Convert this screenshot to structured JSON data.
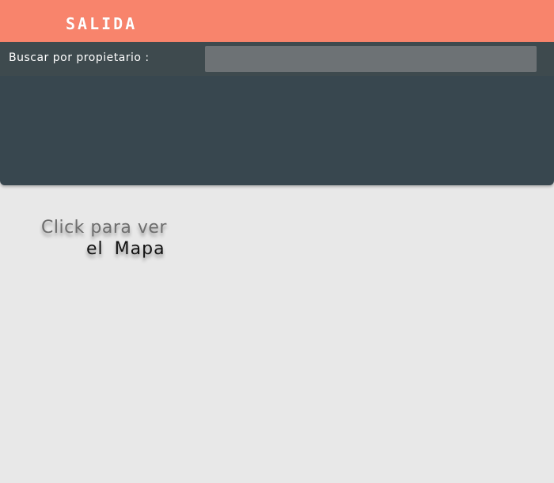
{
  "header": {
    "title": "SALIDA",
    "background_color": "#f8846c"
  },
  "search": {
    "label": "Buscar por propietario :",
    "value": "",
    "placeholder": ""
  },
  "panel": {
    "background_color": "#38474f"
  },
  "map_link": {
    "line1": "Click para ver",
    "line2": "el  Mapa"
  }
}
